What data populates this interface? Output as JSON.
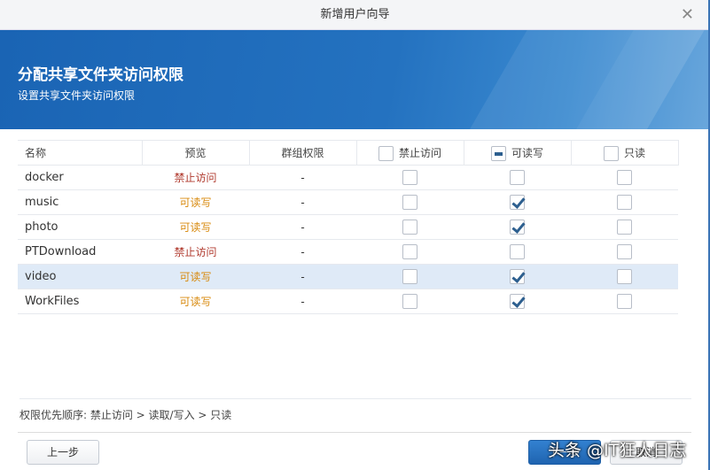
{
  "window": {
    "title": "新增用户向导"
  },
  "banner": {
    "title": "分配共享文件夹访问权限",
    "subtitle": "设置共享文件夹访问权限"
  },
  "table": {
    "headers": {
      "name": "名称",
      "preview": "预览",
      "group": "群组权限",
      "deny": "禁止访问",
      "rw": "可读写",
      "ro": "只读"
    },
    "header_states": {
      "deny": "unchecked",
      "rw": "mixed",
      "ro": "unchecked"
    },
    "rows": [
      {
        "name": "docker",
        "preview": "禁止访问",
        "group": "-",
        "deny": false,
        "rw": false,
        "ro": false
      },
      {
        "name": "music",
        "preview": "可读写",
        "group": "-",
        "deny": false,
        "rw": true,
        "ro": false
      },
      {
        "name": "photo",
        "preview": "可读写",
        "group": "-",
        "deny": false,
        "rw": true,
        "ro": false
      },
      {
        "name": "PTDownload",
        "preview": "禁止访问",
        "group": "-",
        "deny": false,
        "rw": false,
        "ro": false
      },
      {
        "name": "video",
        "preview": "可读写",
        "group": "-",
        "deny": false,
        "rw": true,
        "ro": false,
        "selected": true
      },
      {
        "name": "WorkFiles",
        "preview": "可读写",
        "group": "-",
        "deny": false,
        "rw": true,
        "ro": false
      }
    ]
  },
  "note": "权限优先顺序: 禁止访问 > 读取/写入 > 只读",
  "buttons": {
    "back": "上一步",
    "next": "下一步",
    "cancel": "取消"
  },
  "watermark": "头条 @IT狂人日志"
}
